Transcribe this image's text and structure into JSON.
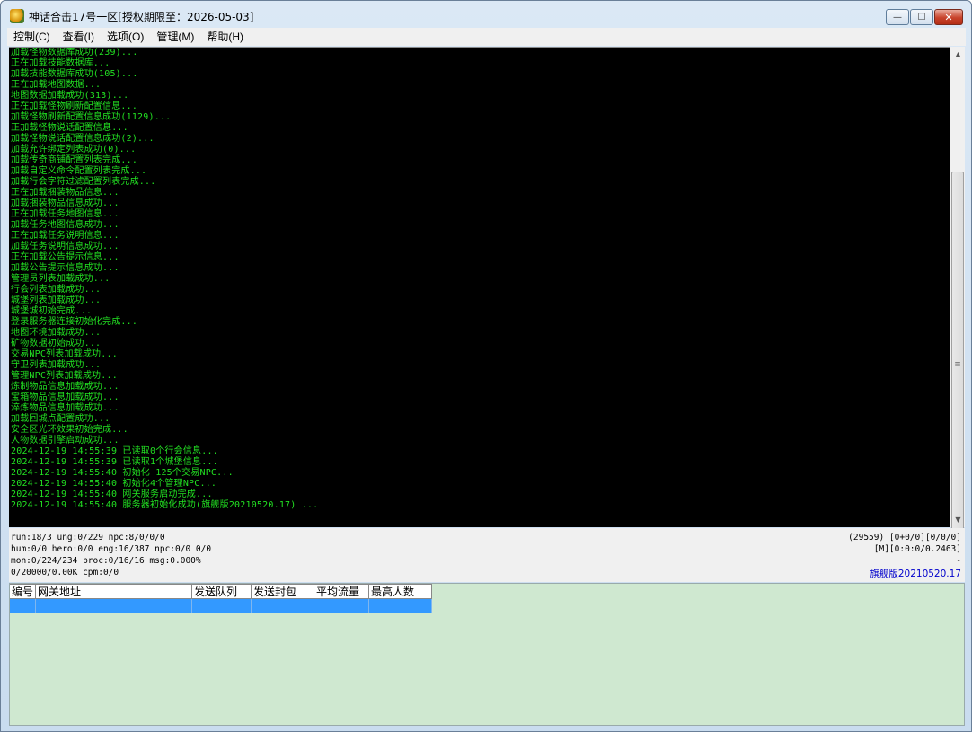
{
  "window": {
    "title": "神话合击17号一区[授权期限至：2026-05-03]",
    "minimize_glyph": "—",
    "maximize_glyph": "☐",
    "close_glyph": "✕"
  },
  "menu": [
    "控制(C)",
    "查看(I)",
    "选项(O)",
    "管理(M)",
    "帮助(H)"
  ],
  "console": {
    "lines": [
      "加载怪物数据库成功(239)...",
      "正在加载技能数据库...",
      "加载技能数据库成功(105)...",
      "正在加载地图数据...",
      "地图数据加载成功(313)...",
      "正在加载怪物刷新配置信息...",
      "加载怪物刷新配置信息成功(1129)...",
      "正加载怪物说话配置信息...",
      "加载怪物说话配置信息成功(2)...",
      "加载允许绑定列表成功(0)...",
      "加载传奇商铺配置列表完成...",
      "加载自定义命令配置列表完成...",
      "加载行会字符过滤配置列表完成...",
      "正在加载捆装物品信息...",
      "加载捆装物品信息成功...",
      "正在加载任务地图信息...",
      "加载任务地图信息成功...",
      "正在加载任务说明信息...",
      "加载任务说明信息成功...",
      "正在加载公告提示信息...",
      "加载公告提示信息成功...",
      "管理员列表加载成功...",
      "行会列表加载成功...",
      "城堡列表加载成功...",
      "城堡城初始完成...",
      "登录服务器连接初始化完成...",
      "地图环境加载成功...",
      "矿物数据初始成功...",
      "交易NPC列表加载成功...",
      "守卫列表加载成功...",
      "管理NPC列表加载成功...",
      "炼制物品信息加载成功...",
      "宝箱物品信息加载成功...",
      "淬炼物品信息加载成功...",
      "加载回城点配置成功...",
      "安全区光环效果初始完成...",
      "人物数据引擎启动成功...",
      "2024-12-19 14:55:39 已读取0个行会信息...",
      "2024-12-19 14:55:39 已读取1个城堡信息...",
      "2024-12-19 14:55:40 初始化 125个交易NPC...",
      "2024-12-19 14:55:40 初始化4个管理NPC...",
      "2024-12-19 14:55:40 网关服务启动完成...",
      "2024-12-19 14:55:40 服务器初始化成功(旗舰版20210520.17) ..."
    ]
  },
  "scrollbar": {
    "up": "▲",
    "down": "▼",
    "grip": "≡"
  },
  "stats": {
    "line1_left": "run:18/3 ung:0/229 npc:8/0/0/0",
    "line1_right": "(29559) [0+0/0][0/0/0]",
    "line2_left": "hum:0/0 hero:0/0 eng:16/387 npc:0/0 0/0",
    "line2_right": "[M][0:0:0/0.2463]",
    "line3_left": "mon:0/224/234 proc:0/16/16 msg:0.000%",
    "line3_right": "-",
    "line4_left": "0/20000/0.00K cpm:0/0",
    "line4_right": "旗舰版20210520.17"
  },
  "grid": {
    "columns": [
      "编号",
      "网关地址",
      "发送队列",
      "发送封包",
      "平均流量",
      "最高人数"
    ]
  }
}
